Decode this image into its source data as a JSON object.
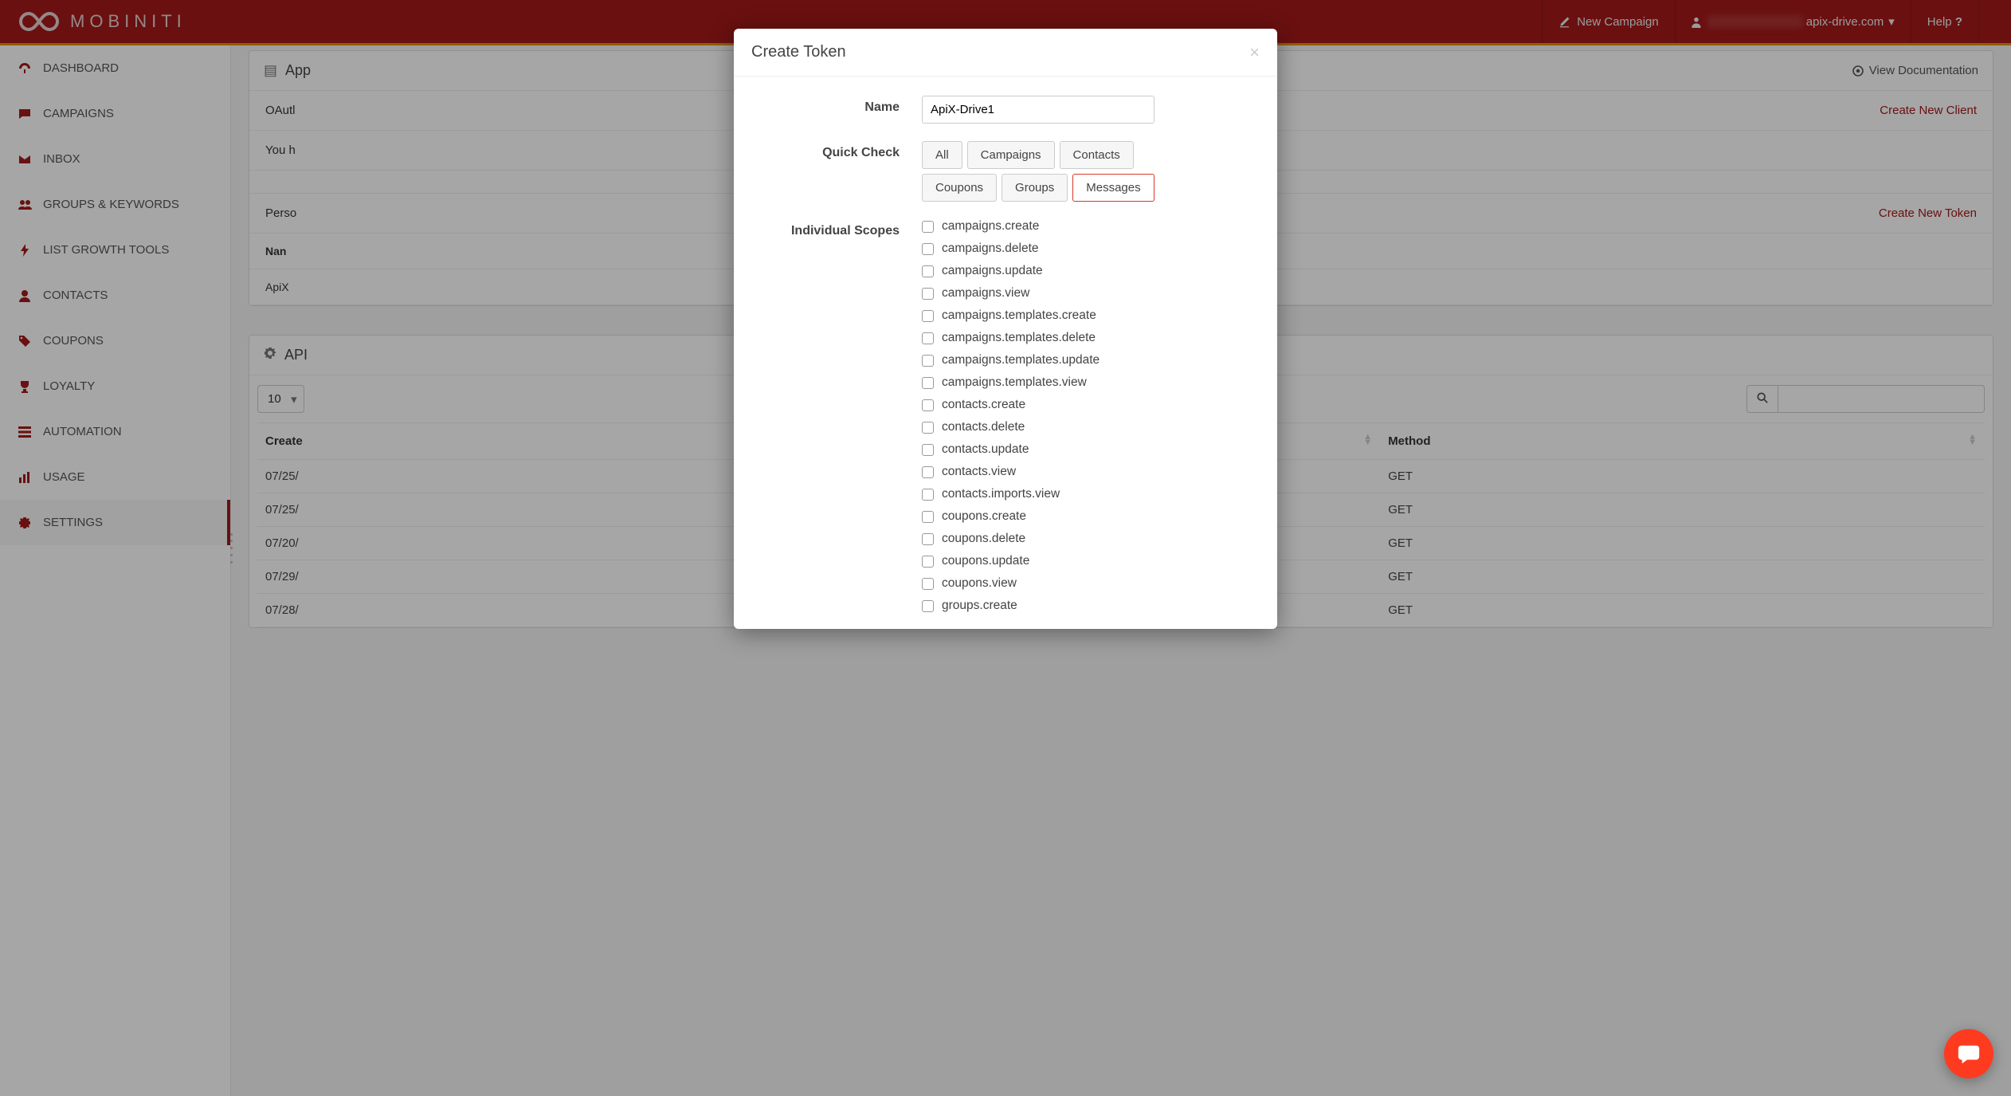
{
  "brand": "MOBINITI",
  "header": {
    "new_campaign": "New Campaign",
    "account_suffix": "apix-drive.com",
    "help": "Help"
  },
  "sidebar": {
    "items": [
      {
        "label": "DASHBOARD",
        "icon": "dashboard"
      },
      {
        "label": "CAMPAIGNS",
        "icon": "comment"
      },
      {
        "label": "INBOX",
        "icon": "envelope"
      },
      {
        "label": "GROUPS & KEYWORDS",
        "icon": "users"
      },
      {
        "label": "LIST GROWTH TOOLS",
        "icon": "bolt"
      },
      {
        "label": "CONTACTS",
        "icon": "user"
      },
      {
        "label": "COUPONS",
        "icon": "tag"
      },
      {
        "label": "LOYALTY",
        "icon": "trophy"
      },
      {
        "label": "AUTOMATION",
        "icon": "tasks"
      },
      {
        "label": "USAGE",
        "icon": "chart"
      },
      {
        "label": "SETTINGS",
        "icon": "gear"
      }
    ],
    "active_index": 10
  },
  "apps_panel": {
    "title_prefix": "App",
    "view_docs": "View Documentation",
    "oauth_row_label": "OAutl",
    "oauth_msg": "You h",
    "create_client": "Create New Client",
    "personal_row_label": "Perso",
    "create_token": "Create New Token",
    "table_head_name": "Nan",
    "table_row_value": "ApiX"
  },
  "api_panel": {
    "title": "API",
    "page_size": "10",
    "columns": {
      "created": "Create",
      "method": "Method"
    },
    "rows": [
      {
        "created": "07/25/",
        "method": "GET"
      },
      {
        "created": "07/25/",
        "method": "GET"
      },
      {
        "created": "07/20/",
        "method": "GET"
      },
      {
        "created": "07/29/",
        "method": "GET"
      },
      {
        "created": "07/28/",
        "method": "GET"
      }
    ]
  },
  "modal": {
    "title": "Create Token",
    "labels": {
      "name": "Name",
      "quick": "Quick Check",
      "scopes": "Individual Scopes"
    },
    "name_value": "ApiX-Drive1",
    "quick": [
      "All",
      "Campaigns",
      "Contacts",
      "Coupons",
      "Groups",
      "Messages"
    ],
    "quick_highlight_index": 5,
    "scopes": [
      "campaigns.create",
      "campaigns.delete",
      "campaigns.update",
      "campaigns.view",
      "campaigns.templates.create",
      "campaigns.templates.delete",
      "campaigns.templates.update",
      "campaigns.templates.view",
      "contacts.create",
      "contacts.delete",
      "contacts.update",
      "contacts.view",
      "contacts.imports.view",
      "coupons.create",
      "coupons.delete",
      "coupons.update",
      "coupons.view",
      "groups.create"
    ]
  }
}
